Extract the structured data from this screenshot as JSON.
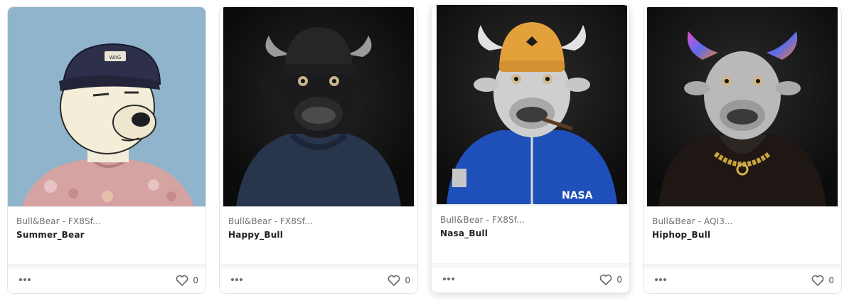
{
  "cards": [
    {
      "collection": "Bull&Bear - FX8Sf...",
      "name": "Summer_Bear",
      "likes": "0",
      "image_icon": "bear-nft-image"
    },
    {
      "collection": "Bull&Bear - FX8Sf...",
      "name": "Happy_Bull",
      "likes": "0",
      "image_icon": "bull-nft-image"
    },
    {
      "collection": "Bull&Bear - FX8Sf...",
      "name": "Nasa_Bull",
      "likes": "0",
      "image_icon": "bull-nft-image"
    },
    {
      "collection": "Bull&Bear - AQI3...",
      "name": "Hiphop_Bull",
      "likes": "0",
      "image_icon": "bull-nft-image"
    }
  ],
  "icons": {
    "more": "more-horizontal-icon",
    "like": "heart-icon"
  },
  "colors": {
    "bear_background": "#8fb4cb",
    "bull_background": "#101010",
    "card_border": "#e4e4e7",
    "collection_text": "#6e6e76",
    "name_text": "#222226"
  }
}
